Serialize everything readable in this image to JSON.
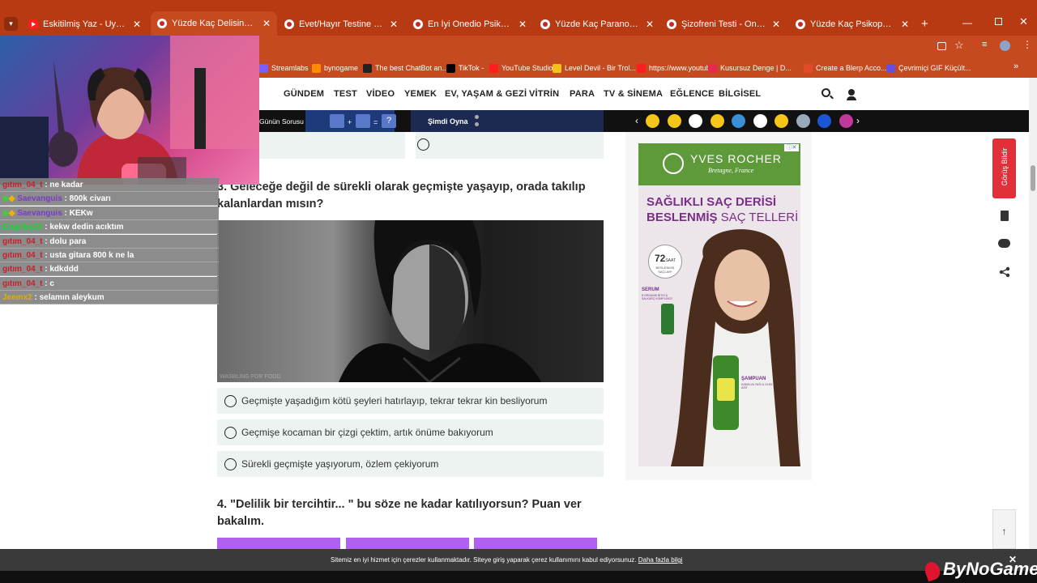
{
  "tabs": [
    {
      "title": "Eskitilmiş Yaz - Uyursam Geçer | ",
      "type": "yt"
    },
    {
      "title": "Yüzde Kaç Delisin? - Onedio",
      "type": "od",
      "active": true
    },
    {
      "title": "Evet/Hayır Testine Göre Ne Kad",
      "type": "od"
    },
    {
      "title": "En İyi Onedio Psikoloji Testleri",
      "type": "od"
    },
    {
      "title": "Yüzde Kaç Paranoyaksın? - One",
      "type": "od"
    },
    {
      "title": "Şizofreni Testi - Onedio",
      "type": "od"
    },
    {
      "title": "Yüzde Kaç Psikopatsın? - Oned",
      "type": "od"
    }
  ],
  "bookmarks": [
    "Streamlabs",
    "bynogame",
    "The best ChatBot an...",
    "TikTok -",
    "YouTube Studio",
    "Level Devil - Bir Trol...",
    "https://www.youtub...",
    "Kusursuz Denge | D...",
    "Create a Blerp Acco...",
    "Çevrimiçi GIF Küçült..."
  ],
  "nav": [
    "GÜNDEM",
    "TEST",
    "VİDEO",
    "YEMEK",
    "EV, YAŞAM & GEZİ",
    "VİTRİN",
    "PARA",
    "TV & SİNEMA",
    "EĞLENCE",
    "BİLGİSEL"
  ],
  "daily": {
    "label": "Günün Sorusu",
    "play": "Şimdi Oyna",
    "q": "?"
  },
  "questions": {
    "q3": "3. Geleceğe değil de sürekli olarak geçmişte yaşayıp, orada takılıp kalanlardan mısın?",
    "q3_answers": [
      "Geçmişte yaşadığım kötü şeyleri hatırlayıp, tekrar tekrar kin besliyorum",
      "Geçmişe kocaman bir çizgi çektim, artık önüme bakıyorum",
      "Sürekli geçmişte yaşıyorum, özlem çekiyorum"
    ],
    "q4": "4. \"Delilik bir tercihtir... \" bu söze ne kadar katılıyorsun? Puan ver bakalım."
  },
  "image_watermark": "WASBLING FOR FOOD",
  "ad": {
    "brand": "YVES ROCHER",
    "sub": "Bretagne, France",
    "line1": "SAĞLIKLI SAÇ DERİSİ",
    "line2a": "BESLENMİŞ",
    "line2b": " SAÇ TELLERİ",
    "badge_num": "72",
    "badge_unit": "SAAT",
    "badge_text": "BESLENMİŞ SAÇLAR*",
    "serum": "SERUM",
    "serum_sub": "8 ORGANİK BİTKİ & SALKARÇ KOMPLEKSİ",
    "shampoo": "ŞAMPUAN",
    "shampoo_sub": "KAMELYA YAĞI & OLEK ASİT"
  },
  "feedback": "Görüş Bildir",
  "cookie": {
    "text": "Sitemiz en iyi hizmet için çerezler kullanmaktadır. Siteye giriş yaparak çerez kullanımını kabul ediyorsunuz.",
    "link": "Daha fazla bilgi",
    "close": "✕"
  },
  "watermark_logo": "ByNoGame",
  "chat": [
    {
      "user": "gıtım_04_t",
      "msg": "ne kadar",
      "color": "#c81e2a"
    },
    {
      "user": "Saevanguis",
      "msg": "800k civarı",
      "color": "#7a3cc8",
      "badges": true
    },
    {
      "user": "Saevanguis",
      "msg": "KEKw",
      "color": "#7a3cc8",
      "badges": true
    },
    {
      "user": "Ertgrlby23",
      "msg": "kekw dedin acıktım",
      "color": "#1fd12b"
    },
    {
      "user": "gıtım_04_t",
      "msg": "dolu para",
      "color": "#c81e2a"
    },
    {
      "user": "gıtım_04_t",
      "msg": "usta gitara 800 k ne la",
      "color": "#c81e2a"
    },
    {
      "user": "gıtım_04_t",
      "msg": "kdkddd",
      "color": "#c81e2a"
    },
    {
      "user": "gıtım_04_t",
      "msg": "c",
      "color": "#c81e2a"
    },
    {
      "user": "Jeemx2",
      "msg": "selamın aleykum",
      "color": "#e0b000"
    }
  ],
  "colors": {
    "tabbar": "#b83a12",
    "toolbar": "#c54a1f",
    "answer_bg": "#edf3f0",
    "ad_green": "#5e9a3a",
    "ad_purple": "#7a2f87",
    "feedback_red": "#e2303a",
    "q4_purple": "#b061f0"
  }
}
